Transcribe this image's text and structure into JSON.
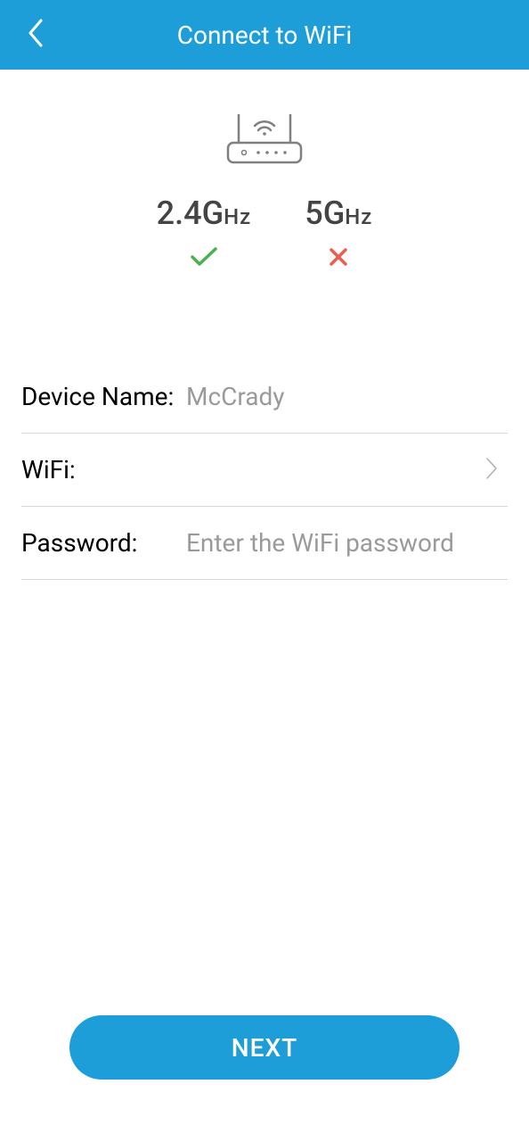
{
  "header": {
    "title": "Connect to WiFi"
  },
  "frequencies": {
    "freq_24": "2.4G",
    "freq_24_suffix": "Hz",
    "freq_24_supported": true,
    "freq_5": "5G",
    "freq_5_suffix": "Hz",
    "freq_5_supported": false
  },
  "form": {
    "device_name_label": "Device Name:",
    "device_name_value": "McCrady",
    "wifi_label": "WiFi:",
    "wifi_value": "",
    "password_label": "Password:",
    "password_placeholder": "Enter the WiFi password",
    "password_value": ""
  },
  "buttons": {
    "next": "NEXT"
  },
  "colors": {
    "primary": "#1d9ed9",
    "check": "#4caf50",
    "cross": "#f15b4e"
  }
}
